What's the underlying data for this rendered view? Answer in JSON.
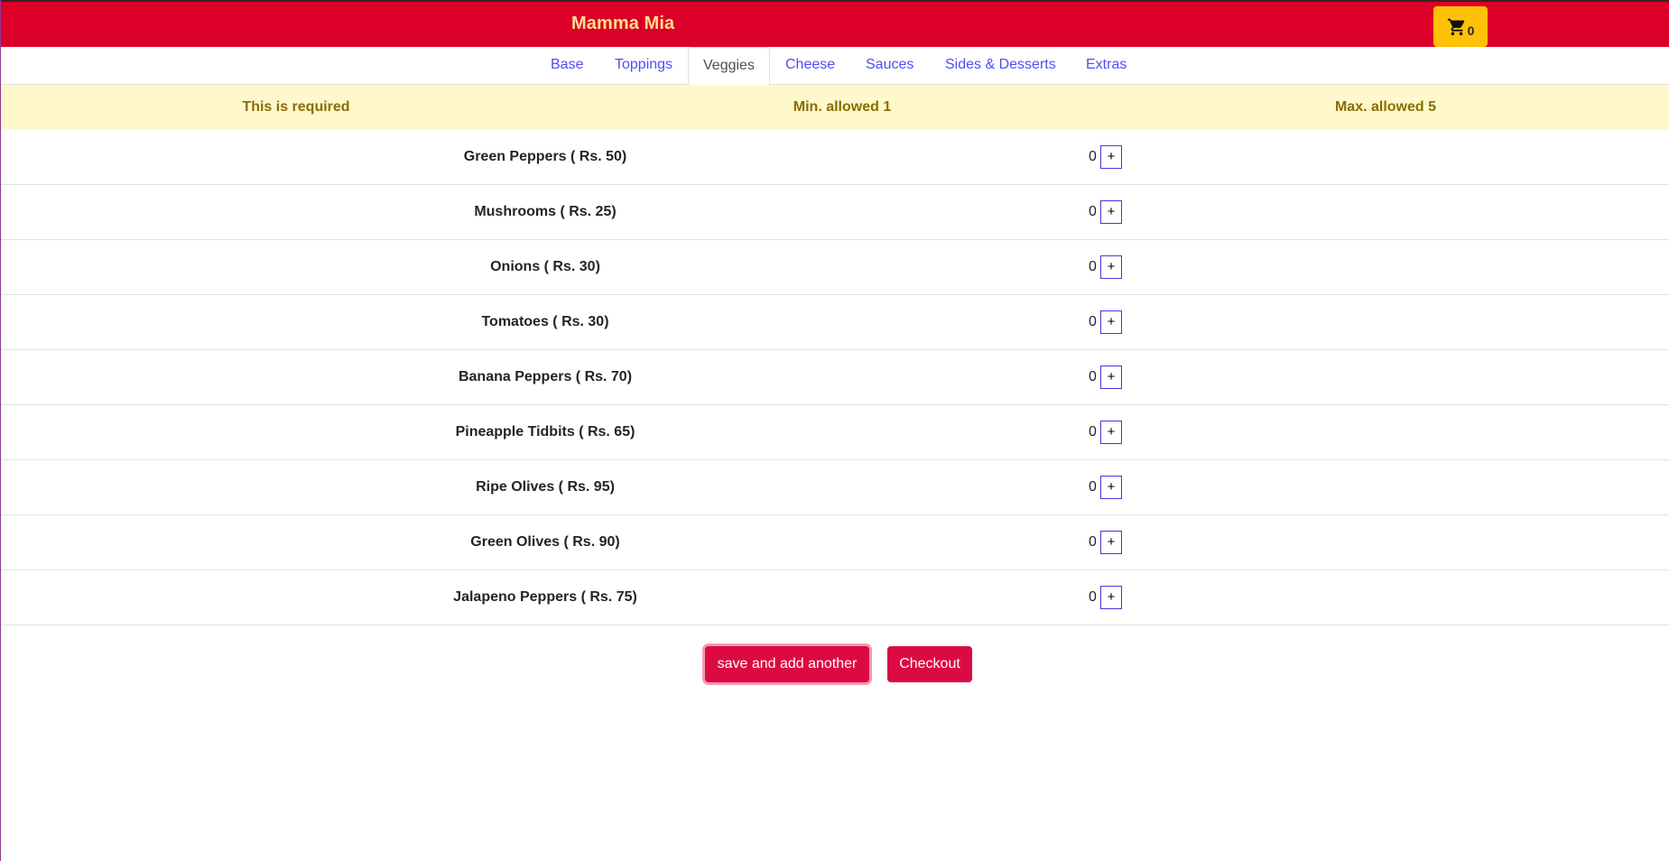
{
  "header": {
    "brand": "Mamma Mia",
    "cart_count": "0",
    "cart_icon": "shopping-cart-icon",
    "background_color": "#dc0028",
    "brand_color": "#ffe08a",
    "cart_button_color": "#ffc107"
  },
  "tabs": [
    {
      "label": "Base",
      "active": false
    },
    {
      "label": "Toppings",
      "active": false
    },
    {
      "label": "Veggies",
      "active": true
    },
    {
      "label": "Cheese",
      "active": false
    },
    {
      "label": "Sauces",
      "active": false
    },
    {
      "label": "Sides & Desserts",
      "active": false
    },
    {
      "label": "Extras",
      "active": false
    }
  ],
  "rules": {
    "required": "This is required",
    "min": "Min. allowed 1",
    "max": "Max. allowed 5"
  },
  "items": [
    {
      "name": "Green Peppers ( Rs. 50)",
      "qty": "0",
      "add": "+"
    },
    {
      "name": "Mushrooms ( Rs. 25)",
      "qty": "0",
      "add": "+"
    },
    {
      "name": "Onions ( Rs. 30)",
      "qty": "0",
      "add": "+"
    },
    {
      "name": "Tomatoes ( Rs. 30)",
      "qty": "0",
      "add": "+"
    },
    {
      "name": "Banana Peppers ( Rs. 70)",
      "qty": "0",
      "add": "+"
    },
    {
      "name": "Pineapple Tidbits ( Rs. 65)",
      "qty": "0",
      "add": "+"
    },
    {
      "name": "Ripe Olives ( Rs. 95)",
      "qty": "0",
      "add": "+"
    },
    {
      "name": "Green Olives ( Rs. 90)",
      "qty": "0",
      "add": "+"
    },
    {
      "name": "Jalapeno Peppers ( Rs. 75)",
      "qty": "0",
      "add": "+"
    }
  ],
  "actions": {
    "save_label": "save and add another",
    "checkout_label": "Checkout",
    "button_color": "#dc0a42"
  }
}
